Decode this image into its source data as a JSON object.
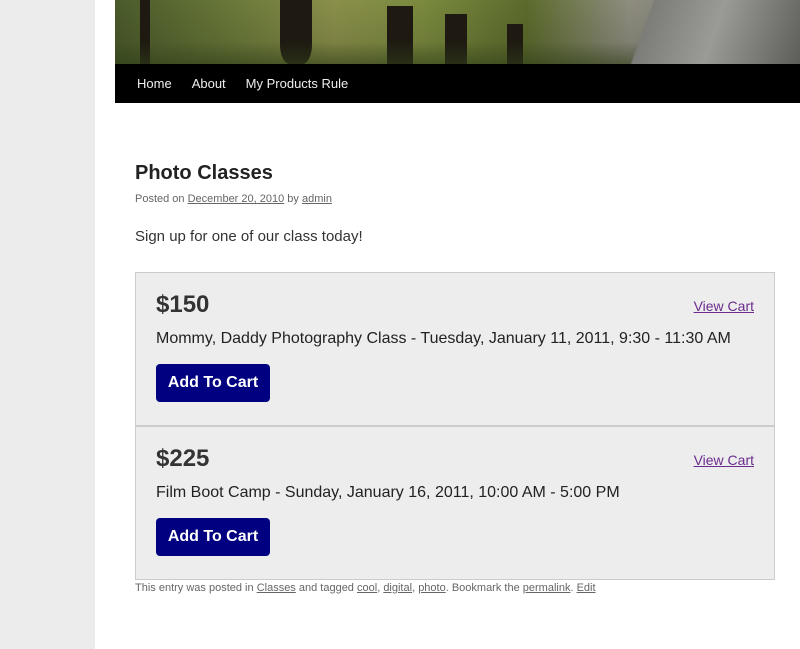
{
  "nav": {
    "items": [
      "Home",
      "About",
      "My Products Rule"
    ]
  },
  "post": {
    "title": "Photo Classes",
    "meta": {
      "posted_on": "Posted on",
      "date": "December 20, 2010",
      "by": "by",
      "author": "admin"
    },
    "intro": "Sign up for one of our class today!",
    "products": [
      {
        "price": "$150",
        "view_cart": "View Cart",
        "title": "Mommy, Daddy Photography Class - Tuesday, January 11, 2011, 9:30 - 11:30 AM",
        "button": "Add To Cart"
      },
      {
        "price": "$225",
        "view_cart": "View Cart",
        "title": "Film Boot Camp - Sunday, January 16, 2011, 10:00 AM - 5:00 PM",
        "button": "Add To Cart"
      }
    ],
    "footer": {
      "prefix": "This entry was posted in",
      "category": "Classes",
      "tagged": "and tagged",
      "tags": [
        "cool",
        "digital",
        "photo"
      ],
      "bookmark": ". Bookmark the",
      "permalink": "permalink",
      "edit": "Edit"
    }
  },
  "colors": {
    "button_bg": "#000080",
    "link_visited": "#6a2c8e",
    "nav_bg": "#000000"
  }
}
